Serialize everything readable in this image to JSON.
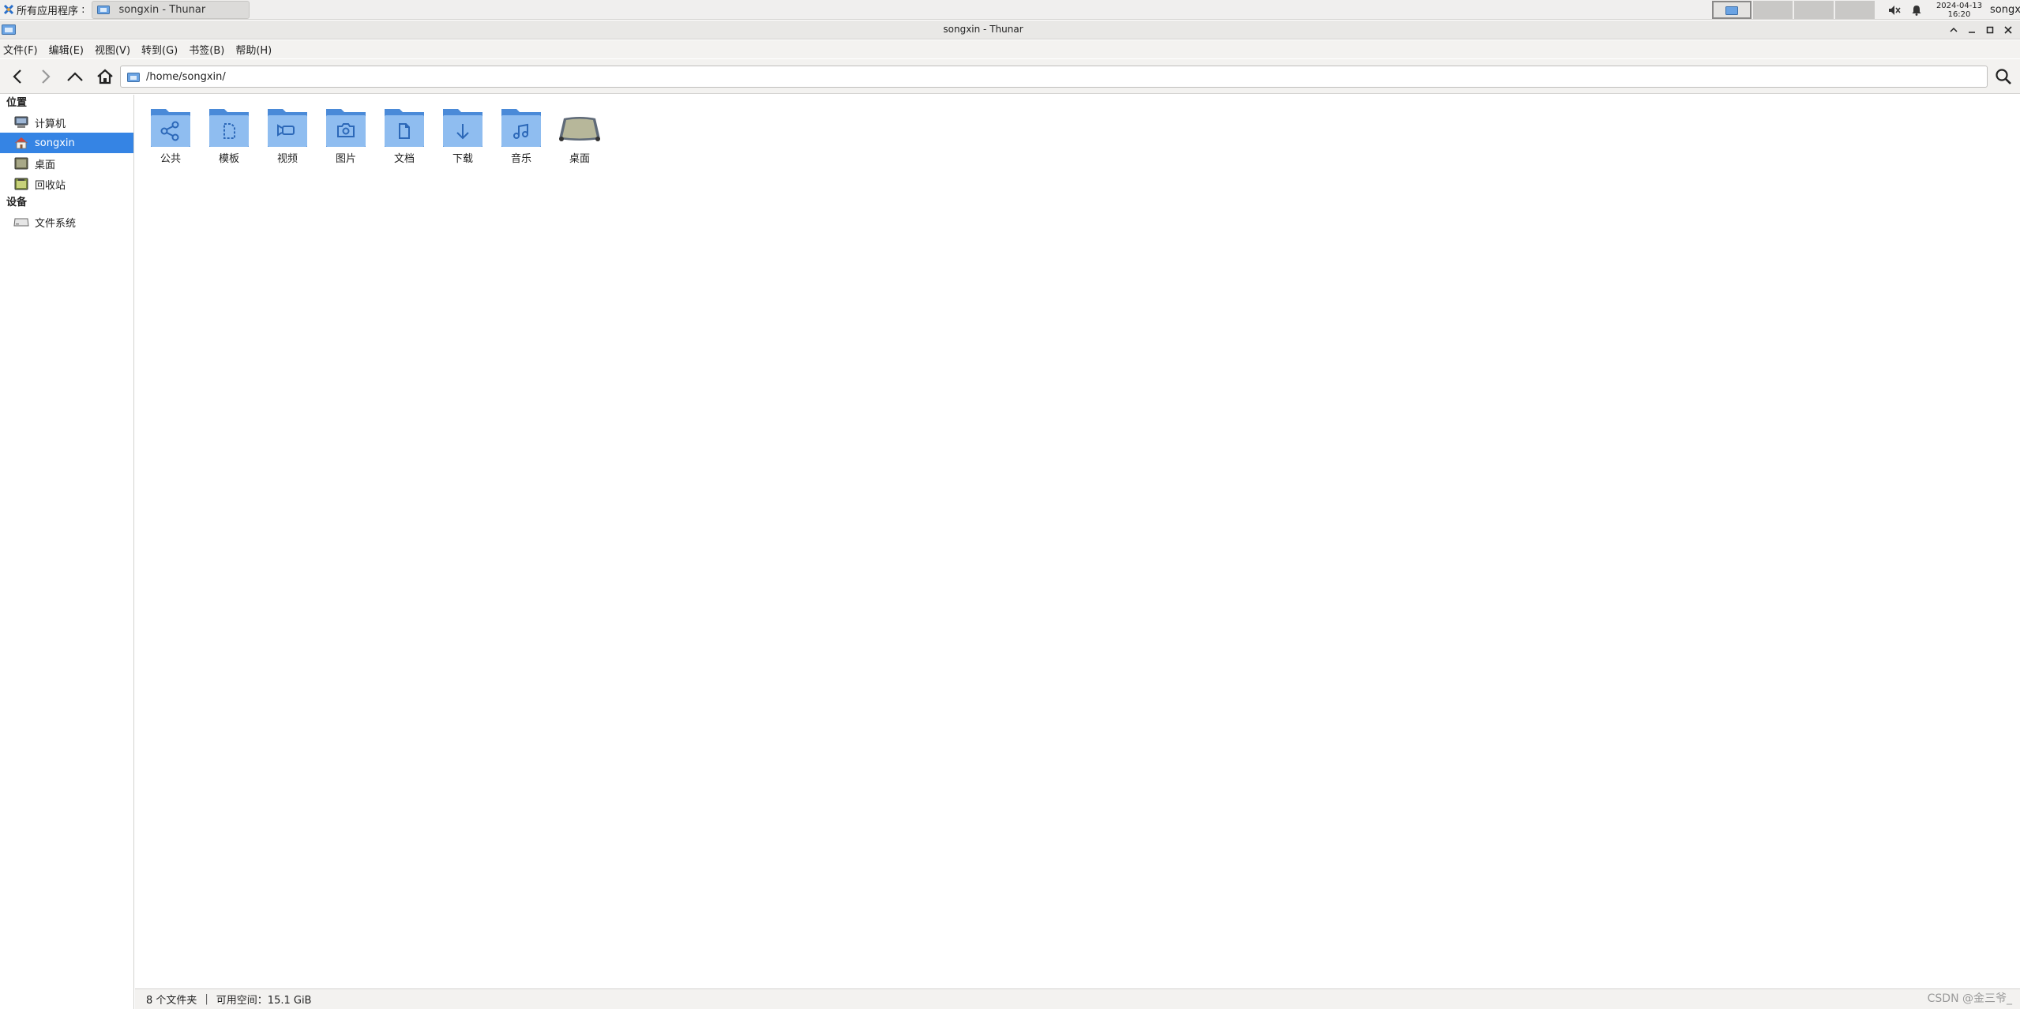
{
  "panel": {
    "apps_label": "所有应用程序",
    "task_label": "songxin - Thunar",
    "clock_date": "2024-04-13",
    "clock_time": "16:20",
    "user": "songxin"
  },
  "window": {
    "title": "songxin - Thunar"
  },
  "menu": [
    "文件(F)",
    "编辑(E)",
    "视图(V)",
    "转到(G)",
    "书签(B)",
    "帮助(H)"
  ],
  "toolbar": {
    "path": "/home/songxin/"
  },
  "sidebar": {
    "places_header": "位置",
    "places": [
      {
        "label": "计算机",
        "icon": "computer-icon"
      },
      {
        "label": "songxin",
        "icon": "home-icon"
      },
      {
        "label": "桌面",
        "icon": "desktop-icon"
      },
      {
        "label": "回收站",
        "icon": "trash-icon"
      }
    ],
    "devices_header": "设备",
    "devices": [
      {
        "label": "文件系统",
        "icon": "drive-icon"
      }
    ]
  },
  "files": [
    {
      "name": "公共",
      "icon": "share-folder-icon"
    },
    {
      "name": "模板",
      "icon": "template-folder-icon"
    },
    {
      "name": "视频",
      "icon": "video-folder-icon"
    },
    {
      "name": "图片",
      "icon": "pictures-folder-icon"
    },
    {
      "name": "文档",
      "icon": "documents-folder-icon"
    },
    {
      "name": "下载",
      "icon": "download-folder-icon"
    },
    {
      "name": "音乐",
      "icon": "music-folder-icon"
    },
    {
      "name": "桌面",
      "icon": "desktop-icon"
    }
  ],
  "status": {
    "count": "8 个文件夹",
    "free": "可用空间：15.1 GiB"
  },
  "watermark": "CSDN @金三爷_",
  "colors": {
    "accent": "#3584e4",
    "folder": "#6aa3e3"
  }
}
